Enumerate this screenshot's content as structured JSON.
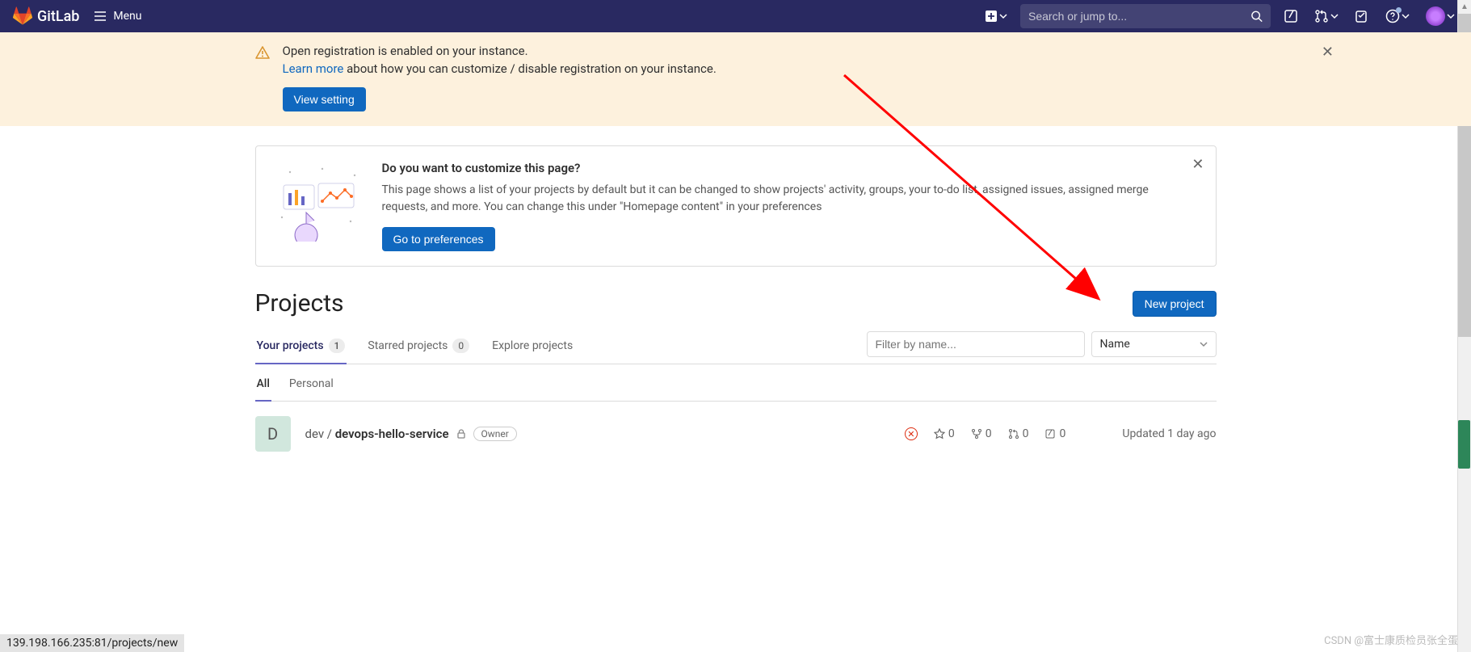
{
  "navbar": {
    "brand": "GitLab",
    "menu_label": "Menu",
    "search_placeholder": "Search or jump to..."
  },
  "alert": {
    "title": "Open registration is enabled on your instance.",
    "learn_more": "Learn more",
    "desc_rest": " about how you can customize / disable registration on your instance.",
    "button": "View setting"
  },
  "customize": {
    "title": "Do you want to customize this page?",
    "desc": "This page shows a list of your projects by default but it can be changed to show projects' activity, groups, your to-do list, assigned issues, assigned merge requests, and more. You can change this under \"Homepage content\" in your preferences",
    "button": "Go to preferences"
  },
  "projects": {
    "heading": "Projects",
    "new_button": "New project",
    "tabs": {
      "your": "Your projects",
      "your_count": "1",
      "starred": "Starred projects",
      "starred_count": "0",
      "explore": "Explore projects"
    },
    "filter_placeholder": "Filter by name...",
    "sort_label": "Name",
    "subtabs": {
      "all": "All",
      "personal": "Personal"
    }
  },
  "project_item": {
    "avatar_letter": "D",
    "namespace": "dev / ",
    "name": "devops-hello-service",
    "role_badge": "Owner",
    "stats": {
      "stars": "0",
      "forks": "0",
      "mrs": "0",
      "issues": "0"
    },
    "updated": "Updated 1 day ago"
  },
  "status_bar": "139.198.166.235:81/projects/new",
  "watermark": "CSDN @富士康质检员张全蛋"
}
